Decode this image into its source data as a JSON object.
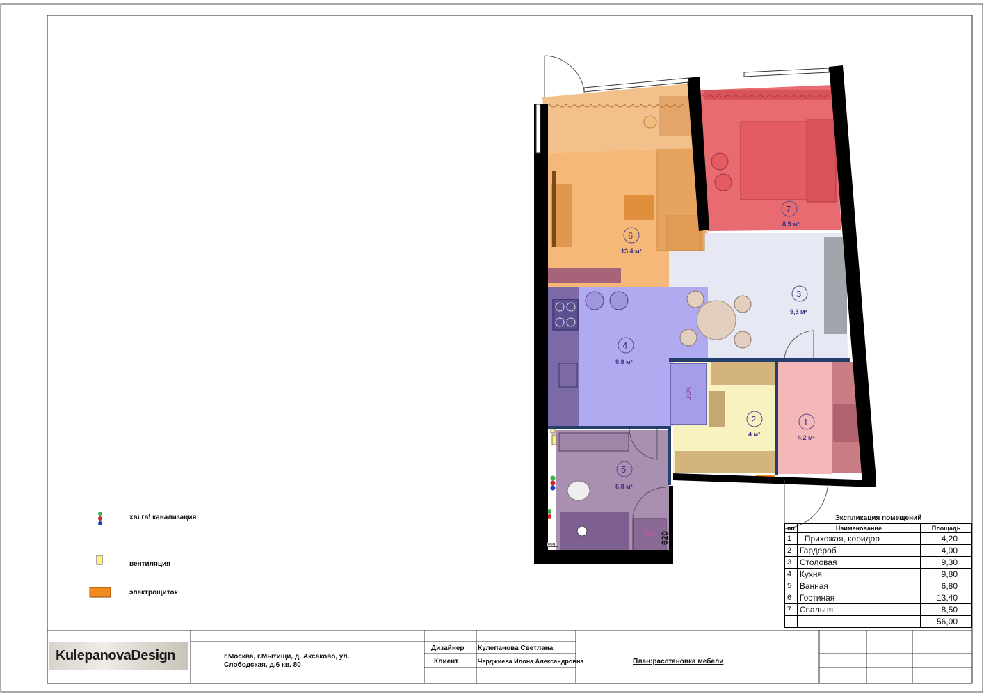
{
  "rooms": [
    {
      "num": "1",
      "area": "4,2 м²"
    },
    {
      "num": "2",
      "area": "4 м²"
    },
    {
      "num": "3",
      "area": "9,3 м²"
    },
    {
      "num": "4",
      "area": "9,8 м²"
    },
    {
      "num": "5",
      "area": "6,8 м²"
    },
    {
      "num": "6",
      "area": "13,4 м²"
    },
    {
      "num": "7",
      "area": "8,5 м²"
    }
  ],
  "fixtures": {
    "fridge_label": "ХОЛ",
    "washer_label": "МС",
    "dim_label": "620",
    "shower_label": "ЩВВ"
  },
  "legend": [
    {
      "label": "хв\\ гв\\ канализация",
      "icon": "pipes-icon"
    },
    {
      "label": "вентиляция",
      "icon": "vent-icon"
    },
    {
      "label": "электрощиток",
      "icon": "panel-icon"
    }
  ],
  "explication": {
    "title": "Экспликация помещений",
    "headers": [
      "пп",
      "Наименование",
      "Площадь"
    ],
    "rows": [
      {
        "n": "1",
        "name": "Прихожая, коридор",
        "area": "4,20"
      },
      {
        "n": "2",
        "name": "Гардероб",
        "area": "4,00"
      },
      {
        "n": "3",
        "name": "Столовая",
        "area": "9,30"
      },
      {
        "n": "4",
        "name": "Кухня",
        "area": "9,80"
      },
      {
        "n": "5",
        "name": "Ванная",
        "area": "6,80"
      },
      {
        "n": "6",
        "name": "Гостиная",
        "area": "13,40"
      },
      {
        "n": "7",
        "name": "Спальня",
        "area": "8,50"
      }
    ],
    "total": "56,00"
  },
  "stamp": {
    "logo": "KulepanovaDesign",
    "address_line1": "г.Москва, г.Мытищи, д. Аксаково, ул.",
    "address_line2": "Слободская, д.6 кв. 80",
    "designer_label": "Дизайнер",
    "designer": "Кулепанова Светлана",
    "client_label": "Клиент",
    "client": "Черджиева Илона Александровна",
    "sheet": "План:расстановка мебели"
  },
  "colors": {
    "wall": "#000000",
    "hall": "#f5b8b8",
    "wardrobe": "#f8f2c0",
    "dining": "#e6e8f4",
    "kitchen": "#b0aaf0",
    "bath": "#a98fb0",
    "living": "#f6b879",
    "bedroom": "#e86b72",
    "furniture_living": "#e6a45e",
    "furniture_bed": "#d9535a",
    "electro": "#f28a1e"
  }
}
